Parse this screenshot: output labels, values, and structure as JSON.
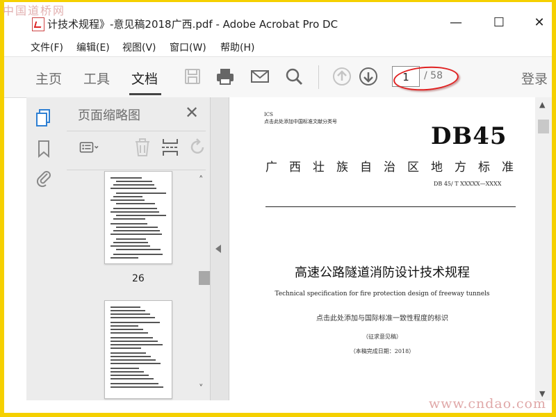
{
  "watermarks": {
    "top": "中国道桥网",
    "bottom": "www.cndao.com"
  },
  "window": {
    "title": "计技术规程》-意见稿2018广西.pdf - Adobe Acrobat Pro DC",
    "controls": {
      "minimize": "—",
      "maximize": "☐",
      "close": "✕"
    }
  },
  "menu": [
    "文件(F)",
    "编辑(E)",
    "视图(V)",
    "窗口(W)",
    "帮助(H)"
  ],
  "toolbar": {
    "tabs": [
      "主页",
      "工具",
      "文档"
    ],
    "active_tab": "文档",
    "icons": [
      "save-icon",
      "print-icon",
      "email-icon",
      "search-icon",
      "previous-page-icon",
      "next-page-icon"
    ],
    "page_current": "1",
    "page_total": "/ 58",
    "login": "登录"
  },
  "rail_icons": [
    "page-thumbnails-icon",
    "bookmark-icon",
    "attachment-icon"
  ],
  "thumbnail_panel": {
    "title": "页面缩略图",
    "close": "✕",
    "tool_icons": [
      "options-menu-icon",
      "delete-page-icon",
      "extract-page-icon",
      "rotate-page-icon"
    ],
    "thumbnails": [
      {
        "label": "26"
      }
    ]
  },
  "document": {
    "ics": "ICS",
    "ics_placeholder": "点击此处添加中国标准文献分类号",
    "standard_code": "DB45",
    "region_title": "广西壮族自治区地方标准",
    "doc_number": "DB 45/ T XXXXX—XXXX",
    "cn_title": "高速公路隧道消防设计技术规程",
    "en_title": "Technical specification for fire protection design of freeway tunnels",
    "intl_consistency": "点击此处添加与国际标准一致性程度的标识",
    "draft_note": "（征求意见稿）",
    "completion_date": "（本稿完成日期：2018）"
  },
  "colors": {
    "accent_blue": "#2d7fd3",
    "annotation_red": "#e02020",
    "frame_yellow": "#f5d000"
  }
}
